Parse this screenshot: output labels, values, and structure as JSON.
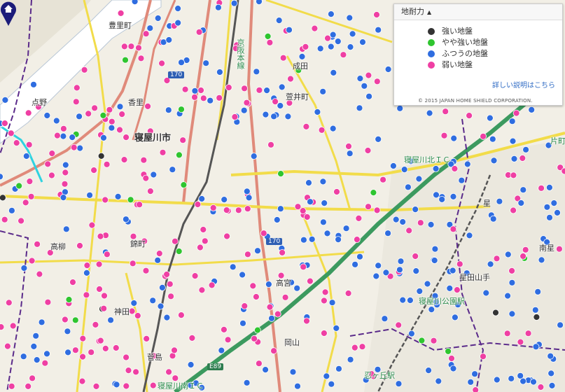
{
  "legend": {
    "title": "地耐力",
    "items": [
      {
        "label": "強い地盤",
        "color": "#333333"
      },
      {
        "label": "やや強い地盤",
        "color": "#2fc52f"
      },
      {
        "label": "ふつうの地盤",
        "color": "#2f6de0"
      },
      {
        "label": "弱い地盤",
        "color": "#ef3fa3"
      }
    ],
    "more_link": "詳しい説明はこちら",
    "copyright": "© 2015 JAPAN HOME SHIELD CORPORATION."
  },
  "places": [
    {
      "text": "豊里町",
      "cls": ""
    },
    {
      "text": "点野",
      "cls": ""
    },
    {
      "text": "成田",
      "cls": ""
    },
    {
      "text": "萱井町",
      "cls": ""
    },
    {
      "text": "寝屋川市",
      "cls": "big"
    },
    {
      "text": "寝屋川北ＩＣ",
      "cls": "station"
    },
    {
      "text": "香里",
      "cls": ""
    },
    {
      "text": "高柳",
      "cls": ""
    },
    {
      "text": "錦町",
      "cls": ""
    },
    {
      "text": "高宮",
      "cls": ""
    },
    {
      "text": "神田",
      "cls": ""
    },
    {
      "text": "星田山手",
      "cls": ""
    },
    {
      "text": "寝屋川公園駅",
      "cls": "station"
    },
    {
      "text": "星",
      "cls": ""
    },
    {
      "text": "南星",
      "cls": ""
    },
    {
      "text": "片町",
      "cls": "station"
    },
    {
      "text": "岡山",
      "cls": ""
    },
    {
      "text": "忍ヶ丘駅",
      "cls": "station"
    },
    {
      "text": "寝屋川南ＩＣ",
      "cls": "station"
    },
    {
      "text": "京阪本線",
      "cls": "station"
    },
    {
      "text": "菅島",
      "cls": ""
    }
  ],
  "routes": [
    "170",
    "170",
    "E89"
  ],
  "markers": {
    "home_pin": "house-pin-icon"
  }
}
